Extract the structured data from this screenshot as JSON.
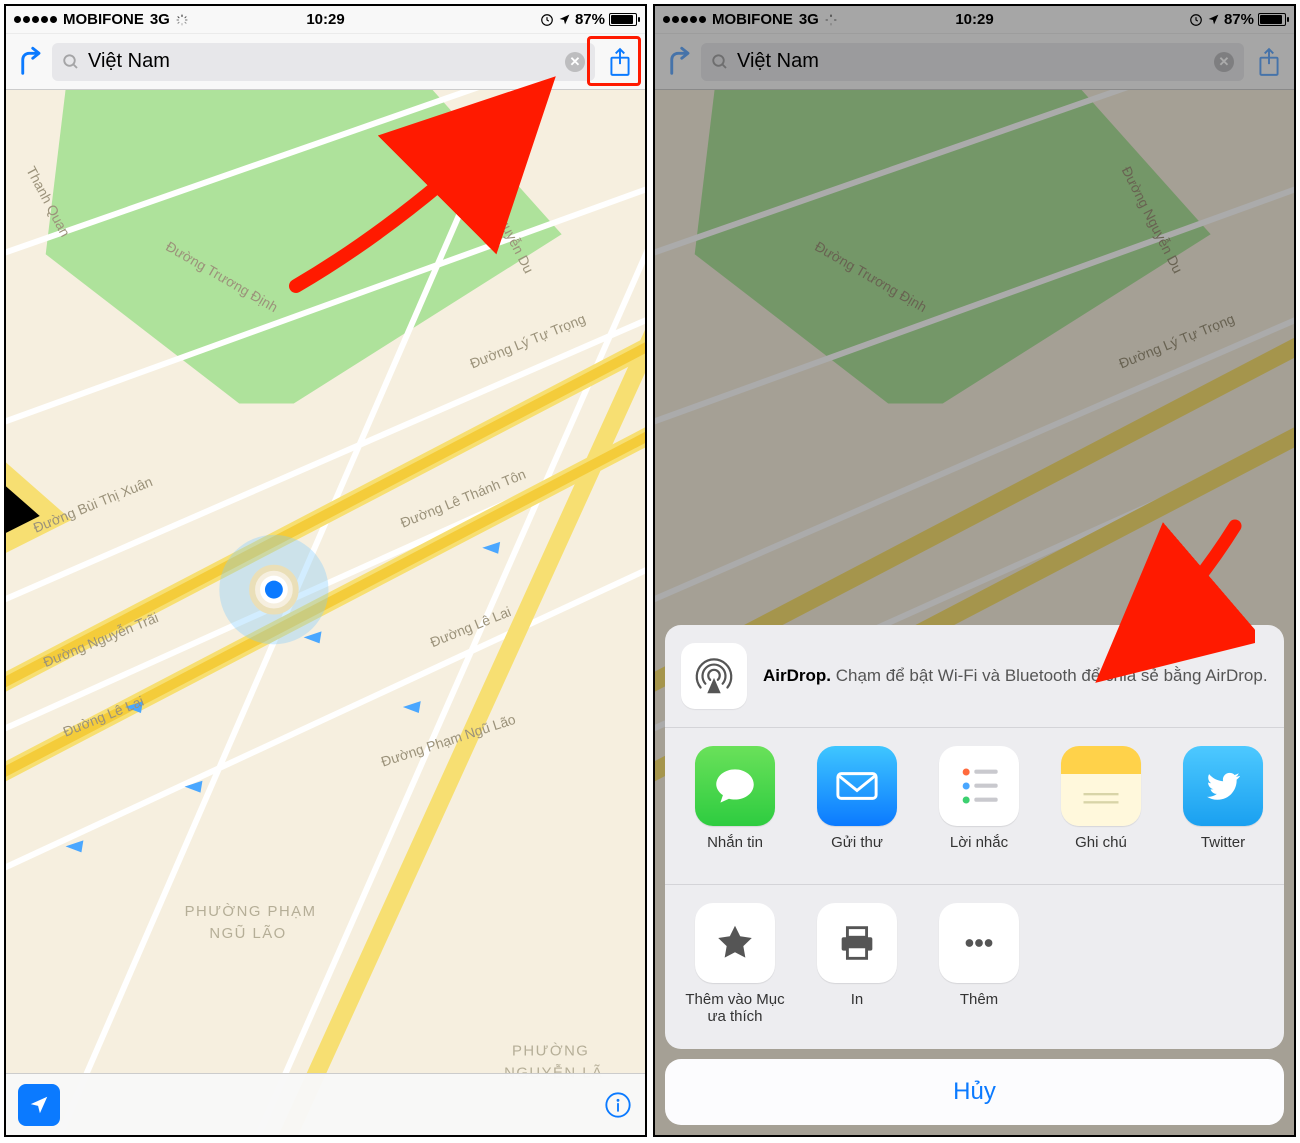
{
  "status": {
    "carrier": "MOBIFONE",
    "network": "3G",
    "time": "10:29",
    "battery_pct": "87%"
  },
  "search": {
    "value": "Việt Nam"
  },
  "map": {
    "district1": "PHƯỜNG PHẠM",
    "district1b": "NGŨ LÃO",
    "district2": "PHƯỜNG",
    "district2b": "NGUYỄN LÃ",
    "roads": {
      "truong_dinh": "Đường Trương Định",
      "nguyen_du": "Đường Nguyễn Du",
      "ly_tu_trong": "Đường Lý Tự Trọng",
      "le_thanh_ton": "Đường Lê Thánh Tôn",
      "le_lai": "Đường Lê Lai",
      "le_lai2": "Đường Lê Lai",
      "pham_ngu_lao": "Đường Phạm Ngũ Lão",
      "nguyen_trai": "Đường Nguyễn Trãi",
      "bui_thi_xuan": "Đường Bùi Thị Xuân",
      "thanh_quan": "Thanh Quan"
    }
  },
  "share": {
    "airdrop_bold": "AirDrop.",
    "airdrop_text": " Chạm để bật Wi-Fi và Bluetooth để chia sẻ bằng AirDrop.",
    "apps": {
      "messages": "Nhắn tin",
      "mail": "Gửi thư",
      "reminders": "Lời nhắc",
      "notes": "Ghi chú",
      "twitter": "Twitter"
    },
    "actions": {
      "favorite": "Thêm vào Mục ưa thích",
      "print": "In",
      "more": "Thêm"
    },
    "cancel": "Hủy"
  }
}
